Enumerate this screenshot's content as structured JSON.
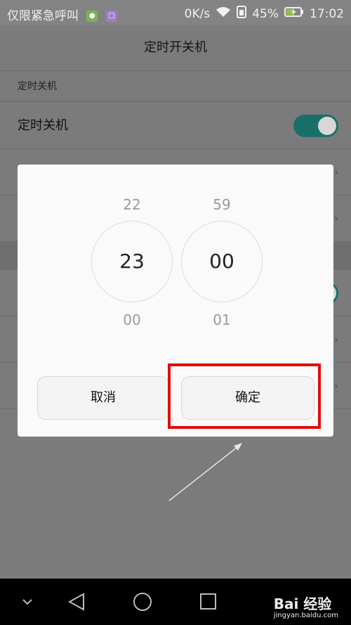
{
  "status_bar": {
    "carrier": "仅限紧急呼叫",
    "speed": "0K/s",
    "battery": "45%",
    "time": "17:02"
  },
  "header": {
    "title": "定时开关机"
  },
  "settings": {
    "section_title": "定时关机",
    "rows": [
      {
        "label": "定时关机",
        "toggle_on": true
      }
    ]
  },
  "dialog": {
    "hours": {
      "prev": "22",
      "selected": "23",
      "next": "00"
    },
    "minutes": {
      "prev": "59",
      "selected": "00",
      "next": "01"
    },
    "cancel_label": "取消",
    "confirm_label": "确定"
  },
  "watermark": {
    "brand": "Bai 经验",
    "url": "jingyan.baidu.com"
  },
  "colors": {
    "toggle_on": "#1b6f6b",
    "highlight": "#e10d0d"
  }
}
